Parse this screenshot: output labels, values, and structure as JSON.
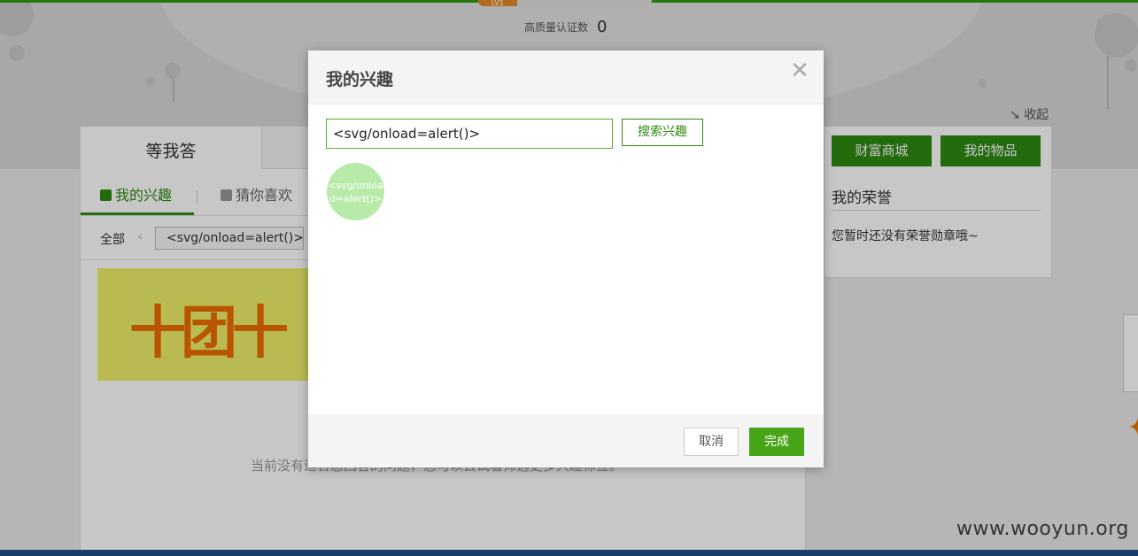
{
  "header": {
    "level_tag": "LV1",
    "quality_label": "高质量认证数",
    "quality_count": "0",
    "collapse_label": "收起"
  },
  "main": {
    "tab_top": "等我答",
    "subtabs": [
      "我的兴趣",
      "猜你喜欢"
    ],
    "filter_all": "全部",
    "filter_chip": "<svg/onload=alert()>",
    "empty_text": "当前没有适合您回答的问题，您可以去试着筛选更多兴趣标签。",
    "promo_text": "十团十"
  },
  "sidebar": {
    "buttons": [
      "财富商城",
      "我的物品"
    ],
    "honor_title": "我的荣誉",
    "honor_empty": "您暂时还没有荣誉勋章哦~"
  },
  "modal": {
    "title": "我的兴趣",
    "close_symbol": "✕",
    "search_value": "<svg/onload=alert()>",
    "search_button": "搜索兴趣",
    "tags": [
      "<svg/onload=alert()>"
    ],
    "cancel_label": "取消",
    "done_label": "完成"
  },
  "watermark": "www.wooyun.org",
  "colors": {
    "brand_green": "#2f8a12",
    "done_green": "#47a317",
    "tag_bubble": "#b8ebaa",
    "footer_blue": "#1d4f8a"
  }
}
